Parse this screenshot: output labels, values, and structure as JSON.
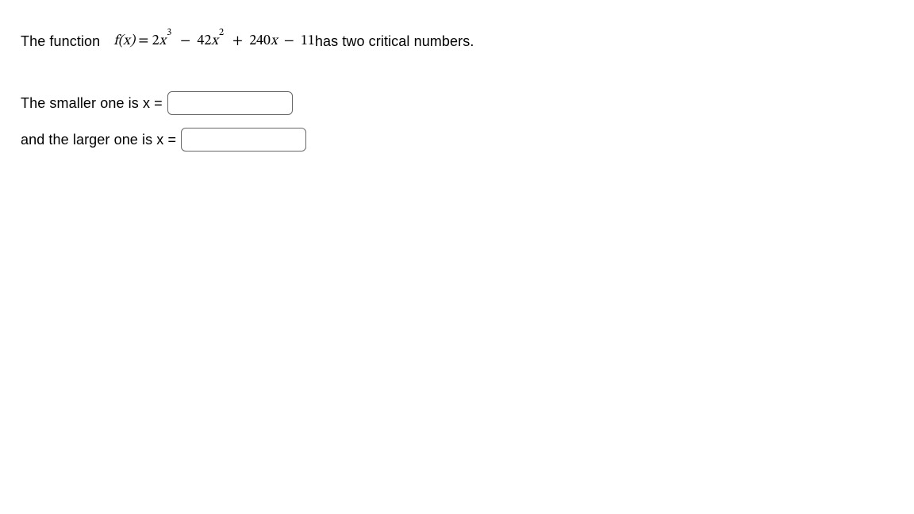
{
  "question": {
    "prefix": "The function ",
    "f_of_x": "f(x)",
    "equals": " = ",
    "term1_coef": "2",
    "term1_base": "x",
    "term1_exp": "3",
    "minus1": " − ",
    "term2_coef": "42",
    "term2_base": "x",
    "term2_exp": "2",
    "plus": " + ",
    "term3": "240",
    "term3_base": "x",
    "minus2": " − ",
    "term4": "11",
    "suffix": " has two critical numbers."
  },
  "prompt1": {
    "label": "The smaller one is x = ",
    "value": ""
  },
  "prompt2": {
    "label": "and the larger one is x = ",
    "value": ""
  }
}
